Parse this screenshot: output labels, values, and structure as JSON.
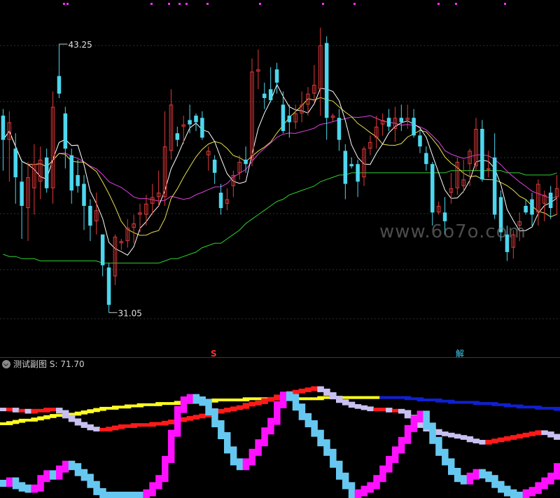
{
  "watermark": "www.6o7o.com",
  "main": {
    "high_label": "43.25",
    "low_label": "31.05",
    "signal_s": "S",
    "signal_jie": "解"
  },
  "sub": {
    "title": "测试副图",
    "value_label": "S: 71.70"
  },
  "colors": {
    "up": "#e03a3a",
    "down": "#4dd7ee",
    "ma5": "#ffffff",
    "ma10": "#e8e050",
    "ma20": "#e040e0",
    "ma60": "#30d030",
    "grid": "#2a3038",
    "step_magenta": "#ff10ff",
    "step_cyan": "#66c8f0",
    "step_lavender": "#c8c0f0",
    "step_red": "#ff1a1a",
    "step_yellow": "#ffff20",
    "step_blue": "#1020d0"
  },
  "chart_data": {
    "type": "candlestick",
    "ylim": [
      29.5,
      45.0
    ],
    "ohlc": [
      [
        40.0,
        40.3,
        37.5,
        38.9
      ],
      [
        38.9,
        40.2,
        37.0,
        39.7
      ],
      [
        38.5,
        39.2,
        36.0,
        37.2
      ],
      [
        37.0,
        38.0,
        34.4,
        35.9
      ],
      [
        35.8,
        37.9,
        34.3,
        37.2
      ],
      [
        36.7,
        38.7,
        35.5,
        37.8
      ],
      [
        37.0,
        38.6,
        36.2,
        38.0
      ],
      [
        38.1,
        38.5,
        36.5,
        36.7
      ],
      [
        36.7,
        41.1,
        36.0,
        40.4
      ],
      [
        41.8,
        43.25,
        40.8,
        41.0
      ],
      [
        40.1,
        40.4,
        37.6,
        38.5
      ],
      [
        38.2,
        38.5,
        36.0,
        36.6
      ],
      [
        37.3,
        38.0,
        36.5,
        36.8
      ],
      [
        36.9,
        37.3,
        34.8,
        35.9
      ],
      [
        35.9,
        36.2,
        34.3,
        35.0
      ],
      [
        35.2,
        36.5,
        34.6,
        35.7
      ],
      [
        34.6,
        34.6,
        32.7,
        33.2
      ],
      [
        33.1,
        33.3,
        31.05,
        31.4
      ],
      [
        32.7,
        34.6,
        32.3,
        34.5
      ],
      [
        34.2,
        34.4,
        33.9,
        34.3
      ],
      [
        34.3,
        35.3,
        34.0,
        34.9
      ],
      [
        34.9,
        35.5,
        34.2,
        35.1
      ],
      [
        35.5,
        36.0,
        34.7,
        35.6
      ],
      [
        35.5,
        36.4,
        35.0,
        36.0
      ],
      [
        36.0,
        36.9,
        35.5,
        36.3
      ],
      [
        36.3,
        37.5,
        35.9,
        36.5
      ],
      [
        36.3,
        40.2,
        35.9,
        38.6
      ],
      [
        38.4,
        41.2,
        38.0,
        40.5
      ],
      [
        39.2,
        39.5,
        38.6,
        38.9
      ],
      [
        39.5,
        40.0,
        38.7,
        39.6
      ],
      [
        39.8,
        40.5,
        39.2,
        39.6
      ],
      [
        40.0,
        40.1,
        39.3,
        39.7
      ],
      [
        39.9,
        40.2,
        38.9,
        39.0
      ],
      [
        38.2,
        38.6,
        37.5,
        38.4
      ],
      [
        38.0,
        38.2,
        36.9,
        37.4
      ],
      [
        36.5,
        36.9,
        35.5,
        35.8
      ],
      [
        36.0,
        36.7,
        35.7,
        36.2
      ],
      [
        36.8,
        37.5,
        36.3,
        37.3
      ],
      [
        37.4,
        38.2,
        37.1,
        37.9
      ],
      [
        38.0,
        38.6,
        37.4,
        37.8
      ],
      [
        38.0,
        42.6,
        37.7,
        42.0
      ],
      [
        42.0,
        43.0,
        41.2,
        42.1
      ],
      [
        41.0,
        41.5,
        40.3,
        40.8
      ],
      [
        41.2,
        42.2,
        40.6,
        40.7
      ],
      [
        42.1,
        42.4,
        41.0,
        41.5
      ],
      [
        40.5,
        41.1,
        39.2,
        39.3
      ],
      [
        40.0,
        40.5,
        39.0,
        39.7
      ],
      [
        39.7,
        40.5,
        39.4,
        40.1
      ],
      [
        40.1,
        41.1,
        39.7,
        40.5
      ],
      [
        40.5,
        41.3,
        40.0,
        41.0
      ],
      [
        41.0,
        42.3,
        40.6,
        41.4
      ],
      [
        41.2,
        44.0,
        40.0,
        43.2
      ],
      [
        43.3,
        43.6,
        38.9,
        39.9
      ],
      [
        39.9,
        40.1,
        39.7,
        40.0
      ],
      [
        39.9,
        40.3,
        38.4,
        38.9
      ],
      [
        38.4,
        38.7,
        36.2,
        36.9
      ],
      [
        37.8,
        38.1,
        37.6,
        37.7
      ],
      [
        37.8,
        38.0,
        36.3,
        37.0
      ],
      [
        37.2,
        38.6,
        36.8,
        38.5
      ],
      [
        38.5,
        39.1,
        38.2,
        38.8
      ],
      [
        39.0,
        40.0,
        38.5,
        39.5
      ],
      [
        39.6,
        40.1,
        39.1,
        39.8
      ],
      [
        39.9,
        40.3,
        39.3,
        39.5
      ],
      [
        39.4,
        40.4,
        38.8,
        39.9
      ],
      [
        39.9,
        40.5,
        39.3,
        39.7
      ],
      [
        39.8,
        40.5,
        39.4,
        39.9
      ],
      [
        39.9,
        40.3,
        39.0,
        39.1
      ],
      [
        39.1,
        39.4,
        38.3,
        38.6
      ],
      [
        38.3,
        38.6,
        37.5,
        37.8
      ],
      [
        37.8,
        37.9,
        35.0,
        35.6
      ],
      [
        35.6,
        36.1,
        35.5,
        35.9
      ],
      [
        35.6,
        36.3,
        34.6,
        35.2
      ],
      [
        36.5,
        37.4,
        36.0,
        36.7
      ],
      [
        36.7,
        38.1,
        36.4,
        37.9
      ],
      [
        36.8,
        38.0,
        36.5,
        37.1
      ],
      [
        37.8,
        38.5,
        36.8,
        38.4
      ],
      [
        37.7,
        39.9,
        37.5,
        39.4
      ],
      [
        39.4,
        39.8,
        37.0,
        37.1
      ],
      [
        37.6,
        38.4,
        37.2,
        37.6
      ],
      [
        38.1,
        39.2,
        35.3,
        35.5
      ],
      [
        36.3,
        36.6,
        34.3,
        34.7
      ],
      [
        34.6,
        35.0,
        33.4,
        33.8
      ],
      [
        34.0,
        34.8,
        33.5,
        34.6
      ],
      [
        35.0,
        35.6,
        34.3,
        35.2
      ],
      [
        35.9,
        36.2,
        35.5,
        35.6
      ],
      [
        36.2,
        36.5,
        35.0,
        35.5
      ],
      [
        35.6,
        37.1,
        35.0,
        36.9
      ],
      [
        36.0,
        36.6,
        35.2,
        36.4
      ],
      [
        36.5,
        36.8,
        35.3,
        35.8
      ],
      [
        36.3,
        37.3,
        35.5,
        36.7
      ]
    ],
    "ma60": [
      33.7,
      33.6,
      33.6,
      33.5,
      33.5,
      33.5,
      33.4,
      33.4,
      33.4,
      33.4,
      33.4,
      33.4,
      33.4,
      33.4,
      33.4,
      33.4,
      33.3,
      33.3,
      33.3,
      33.3,
      33.3,
      33.3,
      33.3,
      33.3,
      33.3,
      33.3,
      33.4,
      33.5,
      33.5,
      33.6,
      33.7,
      33.8,
      34.0,
      34.1,
      34.2,
      34.2,
      34.4,
      34.6,
      34.8,
      35.1,
      35.3,
      35.5,
      35.7,
      35.9,
      36.1,
      36.2,
      36.4,
      36.5,
      36.6,
      36.7,
      36.8,
      37.0,
      37.1,
      37.2,
      37.3,
      37.3,
      37.4,
      37.4,
      37.4,
      37.4,
      37.4,
      37.4,
      37.4,
      37.4,
      37.4,
      37.4,
      37.4,
      37.4,
      37.4,
      37.4,
      37.4,
      37.4,
      37.5,
      37.5,
      37.5,
      37.5,
      37.5,
      37.5,
      37.5,
      37.5,
      37.5,
      37.4,
      37.4,
      37.4,
      37.3,
      37.3,
      37.3,
      37.3,
      37.3,
      37.4
    ],
    "sub_chart": {
      "ylim": [
        0,
        100
      ],
      "cyan_magenta_osc": [
        10,
        12,
        8,
        6,
        5,
        6,
        14,
        18,
        16,
        22,
        26,
        24,
        19,
        15,
        9,
        3,
        0,
        0,
        0,
        0,
        0,
        0,
        0,
        2,
        8,
        14,
        30,
        52,
        72,
        80,
        82,
        80,
        78,
        70,
        60,
        50,
        38,
        28,
        24,
        28,
        36,
        44,
        54,
        62,
        76,
        84,
        82,
        74,
        66,
        60,
        52,
        44,
        36,
        26,
        16,
        8,
        0,
        2,
        5,
        8,
        14,
        22,
        30,
        38,
        46,
        56,
        64,
        68,
        58,
        46,
        36,
        28,
        20,
        14,
        12,
        16,
        19,
        17,
        14,
        9,
        5,
        2,
        0,
        0,
        2,
        4,
        8,
        12,
        16,
        24
      ],
      "slow_line": [
        72,
        72,
        71,
        71,
        70,
        71,
        71,
        72,
        72,
        70,
        66,
        63,
        60,
        58,
        56,
        55,
        55,
        56,
        57,
        58,
        58,
        59,
        59,
        59,
        60,
        60,
        61,
        62,
        63,
        64,
        65,
        66,
        67,
        68,
        70,
        71,
        72,
        73,
        74,
        76,
        77,
        78,
        80,
        81,
        83,
        85,
        86,
        87,
        88,
        89,
        90,
        88,
        85,
        82,
        79,
        77,
        75,
        74,
        73,
        72,
        72,
        72,
        71,
        71,
        70,
        66,
        62,
        58,
        55,
        54,
        52,
        51,
        50,
        49,
        48,
        46,
        45,
        44,
        45,
        46,
        47,
        48,
        49,
        50,
        51,
        52,
        53,
        52,
        50,
        48
      ],
      "yellow_band": [
        60,
        61,
        62,
        63,
        63,
        64,
        65,
        66,
        67,
        67,
        67,
        68,
        69,
        70,
        71,
        72,
        73,
        73,
        74,
        74,
        75,
        75,
        76,
        76,
        76,
        77,
        77,
        77,
        78,
        78,
        78,
        79,
        79,
        79,
        80,
        80,
        80,
        80,
        80,
        81,
        81,
        81,
        81,
        81,
        81,
        81,
        81,
        81,
        81,
        81,
        81,
        82,
        82,
        82,
        82,
        82,
        82,
        82,
        82,
        82,
        82,
        82,
        82,
        82,
        82,
        81,
        81,
        80,
        80,
        80,
        79,
        79,
        78,
        78,
        78,
        78,
        77,
        77,
        77,
        76,
        76,
        75,
        75,
        74,
        74,
        74,
        73,
        73,
        73,
        72
      ]
    }
  }
}
